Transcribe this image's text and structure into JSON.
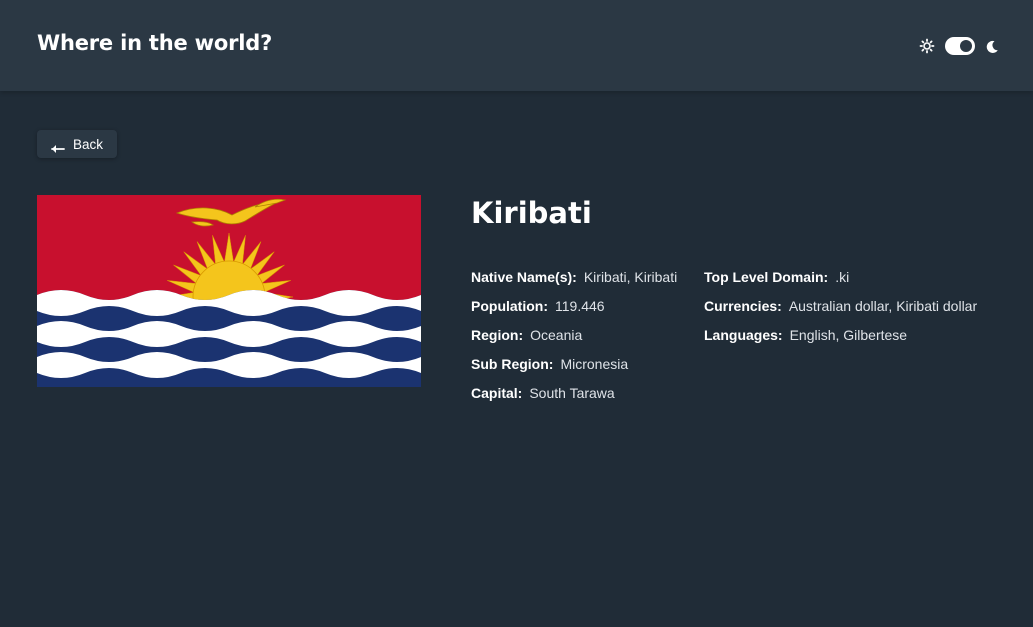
{
  "header": {
    "title": "Where in the world?",
    "theme": {
      "light_icon": "sun-icon",
      "dark_icon": "moon-icon",
      "toggle_state": "dark"
    }
  },
  "back_button": {
    "label": "Back",
    "icon": "arrow-left-icon"
  },
  "country": {
    "name": "Kiribati",
    "flag_alt": "Flag of Kiribati",
    "details_left": [
      {
        "label": "Native Name(s):",
        "value": "Kiribati, Kiribati"
      },
      {
        "label": "Population:",
        "value": "119.446"
      },
      {
        "label": "Region:",
        "value": "Oceania"
      },
      {
        "label": "Sub Region:",
        "value": "Micronesia"
      },
      {
        "label": "Capital:",
        "value": "South Tarawa"
      }
    ],
    "details_right": [
      {
        "label": "Top Level Domain:",
        "value": ".ki"
      },
      {
        "label": "Currencies:",
        "value": "Australian dollar, Kiribati dollar"
      },
      {
        "label": "Languages:",
        "value": "English, Gilbertese"
      }
    ]
  },
  "colors": {
    "background": "#202c37",
    "surface": "#2b3844",
    "text": "#ffffff",
    "flag_red": "#c8102e",
    "flag_blue": "#1b3370",
    "flag_gold": "#f4c51c"
  }
}
